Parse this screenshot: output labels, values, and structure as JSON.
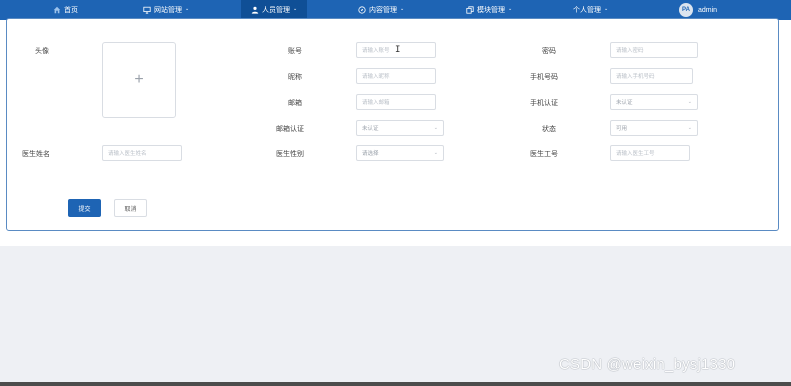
{
  "nav": {
    "items": [
      {
        "label": "首页",
        "icon": "home-icon"
      },
      {
        "label": "网站管理",
        "icon": "monitor-icon",
        "dropdown": true
      },
      {
        "label": "人员管理",
        "icon": "user-icon",
        "dropdown": true,
        "active": true
      },
      {
        "label": "内容管理",
        "icon": "compass-icon",
        "dropdown": true
      },
      {
        "label": "模块管理",
        "icon": "copy-icon",
        "dropdown": true
      },
      {
        "label": "个人管理",
        "icon": null,
        "dropdown": true
      }
    ],
    "user": {
      "avatar_text": "PA",
      "name": "admin"
    }
  },
  "form": {
    "avatar_label": "头像",
    "account_label": "账号",
    "account_placeholder": "请输入账号",
    "password_label": "密码",
    "password_placeholder": "请输入密码",
    "nickname_label": "昵称",
    "nickname_placeholder": "请输入昵称",
    "phone_label": "手机号码",
    "phone_placeholder": "请输入手机号码",
    "email_label": "邮箱",
    "email_placeholder": "请输入邮箱",
    "phone_verify_label": "手机认证",
    "phone_verify_value": "未认证",
    "email_verify_label": "邮箱认证",
    "email_verify_value": "未认证",
    "status_label": "状态",
    "status_value": "可用",
    "student_name_label": "医生姓名",
    "student_name_placeholder": "请输入医生姓名",
    "student_gender_label": "医生性别",
    "student_gender_placeholder": "请选择",
    "student_id_label": "医生工号",
    "student_id_placeholder": "请输入医生工号",
    "submit_label": "提交",
    "cancel_label": "取消"
  },
  "watermark": "CSDN @weixin_bysj1330",
  "colors": {
    "nav_bg": "#1e64b4",
    "nav_active": "#0f4f96",
    "primary": "#1e64b4",
    "panel_border": "#5a8bc3"
  }
}
